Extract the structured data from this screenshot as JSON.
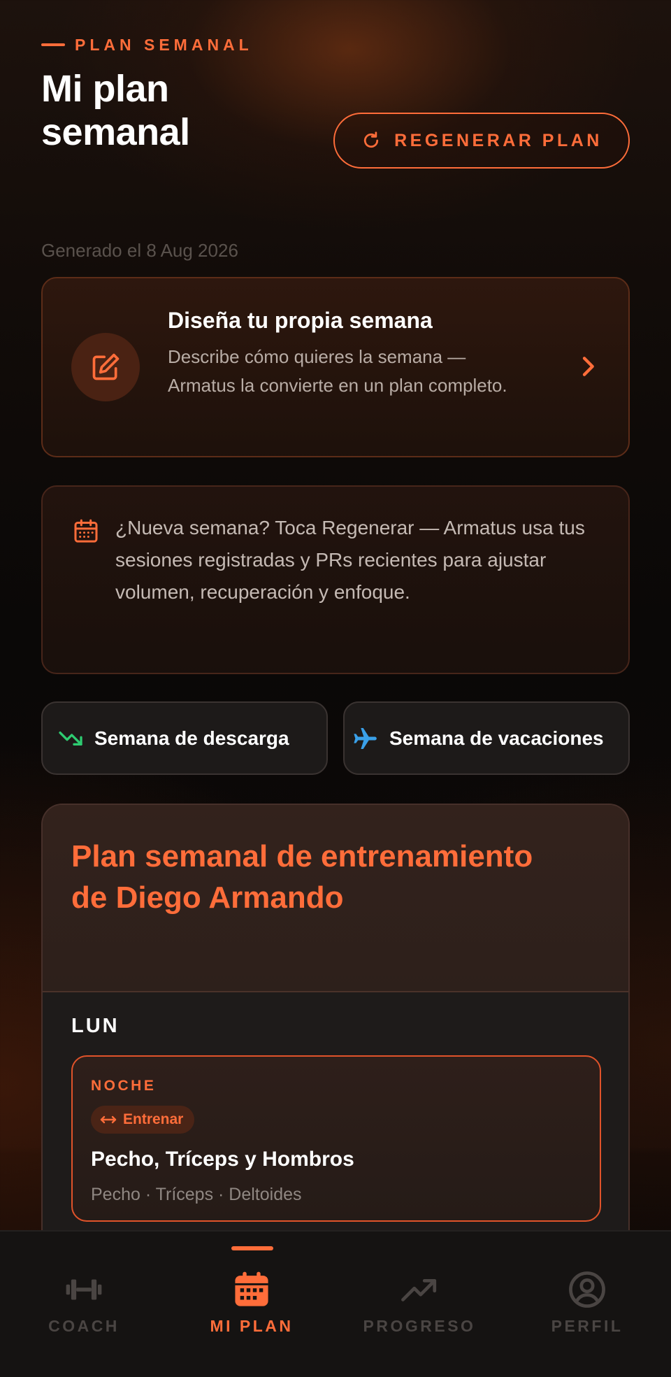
{
  "header": {
    "eyebrow": "PLAN SEMANAL",
    "title": "Mi plan semanal",
    "regenerate_label": "REGENERAR PLAN",
    "generated_text": "Generado el 8 Aug 2026"
  },
  "design_card": {
    "title": "Diseña tu propia semana",
    "description": "Describe cómo quieres la semana — Armatus la convierte en un plan completo."
  },
  "info_card": {
    "text": "¿Nueva semana? Toca Regenerar — Armatus usa tus sesiones registradas y PRs recientes para ajustar volumen, recuperación y enfoque."
  },
  "week_buttons": {
    "deload": "Semana de descarga",
    "vacation": "Semana de vacaciones"
  },
  "plan": {
    "title": "Plan semanal de entrenamiento de Diego Armando",
    "days": [
      {
        "label": "LUN",
        "sessions": [
          {
            "time": "NOCHE",
            "badge": "Entrenar",
            "title": "Pecho, Tríceps y Hombros",
            "muscles": "Pecho · Tríceps · Deltoides"
          }
        ]
      }
    ]
  },
  "nav": {
    "items": [
      {
        "label": "COACH",
        "icon": "dumbbell-icon",
        "active": false
      },
      {
        "label": "MI PLAN",
        "icon": "calendar-icon",
        "active": true
      },
      {
        "label": "PROGRESO",
        "icon": "trending-up-icon",
        "active": false
      },
      {
        "label": "PERFIL",
        "icon": "user-icon",
        "active": false
      }
    ]
  },
  "colors": {
    "accent": "#ff6d3a",
    "background": "#0b0908",
    "card": "#1e1b1a",
    "deload_icon": "#2ecc71",
    "vacation_icon": "#3aa0e8"
  }
}
